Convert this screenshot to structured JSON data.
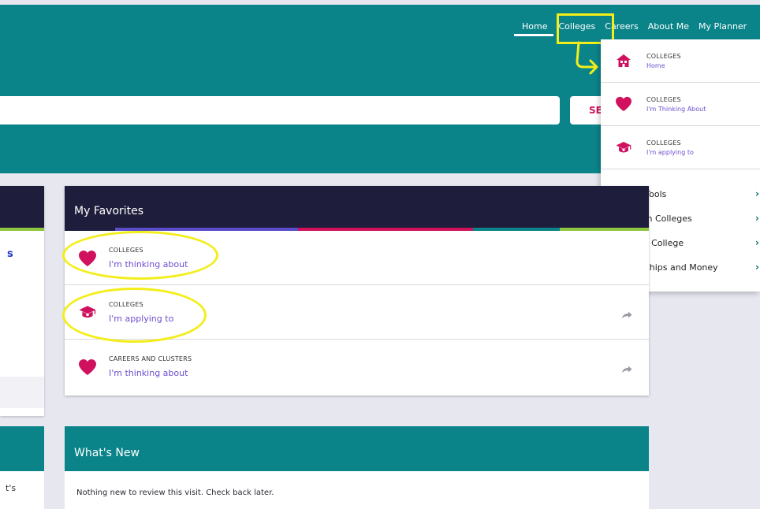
{
  "colors": {
    "header_teal": "#0b8489",
    "card_header_navy": "#1e1d3b",
    "accent_pink": "#d0125e",
    "link_purple": "#6e4fcf",
    "highlight_yellow": "#f3ee1a"
  },
  "top_nav": [
    "Home",
    "Colleges",
    "Careers",
    "About Me",
    "My Planner"
  ],
  "search": {
    "button_label": "SEARCH",
    "placeholder": ""
  },
  "dropdown": {
    "entries": [
      {
        "category": "COLLEGES",
        "label": "Home",
        "icon": "house-icon"
      },
      {
        "category": "COLLEGES",
        "label": "I'm Thinking About",
        "icon": "heart-icon"
      },
      {
        "category": "COLLEGES",
        "label": "I'm applying to",
        "icon": "graduation-cap-icon"
      }
    ],
    "links": [
      "Search Tools",
      "Research Colleges",
      "Apply to College",
      "Scholarships and Money"
    ],
    "chevron": "›"
  },
  "left_card": {
    "link_fragment": "s"
  },
  "left_card2": {
    "text_fragment": "t's"
  },
  "favorites": {
    "title": "My Favorites",
    "items": [
      {
        "category": "COLLEGES",
        "label": "I'm thinking about",
        "icon": "heart-icon"
      },
      {
        "category": "COLLEGES",
        "label": "I'm applying to",
        "icon": "graduation-cap-icon"
      },
      {
        "category": "CAREERS AND CLUSTERS",
        "label": "I'm thinking about",
        "icon": "heart-icon"
      }
    ]
  },
  "whats_new": {
    "title": "What's New",
    "message": "Nothing new to review this visit. Check back later."
  }
}
